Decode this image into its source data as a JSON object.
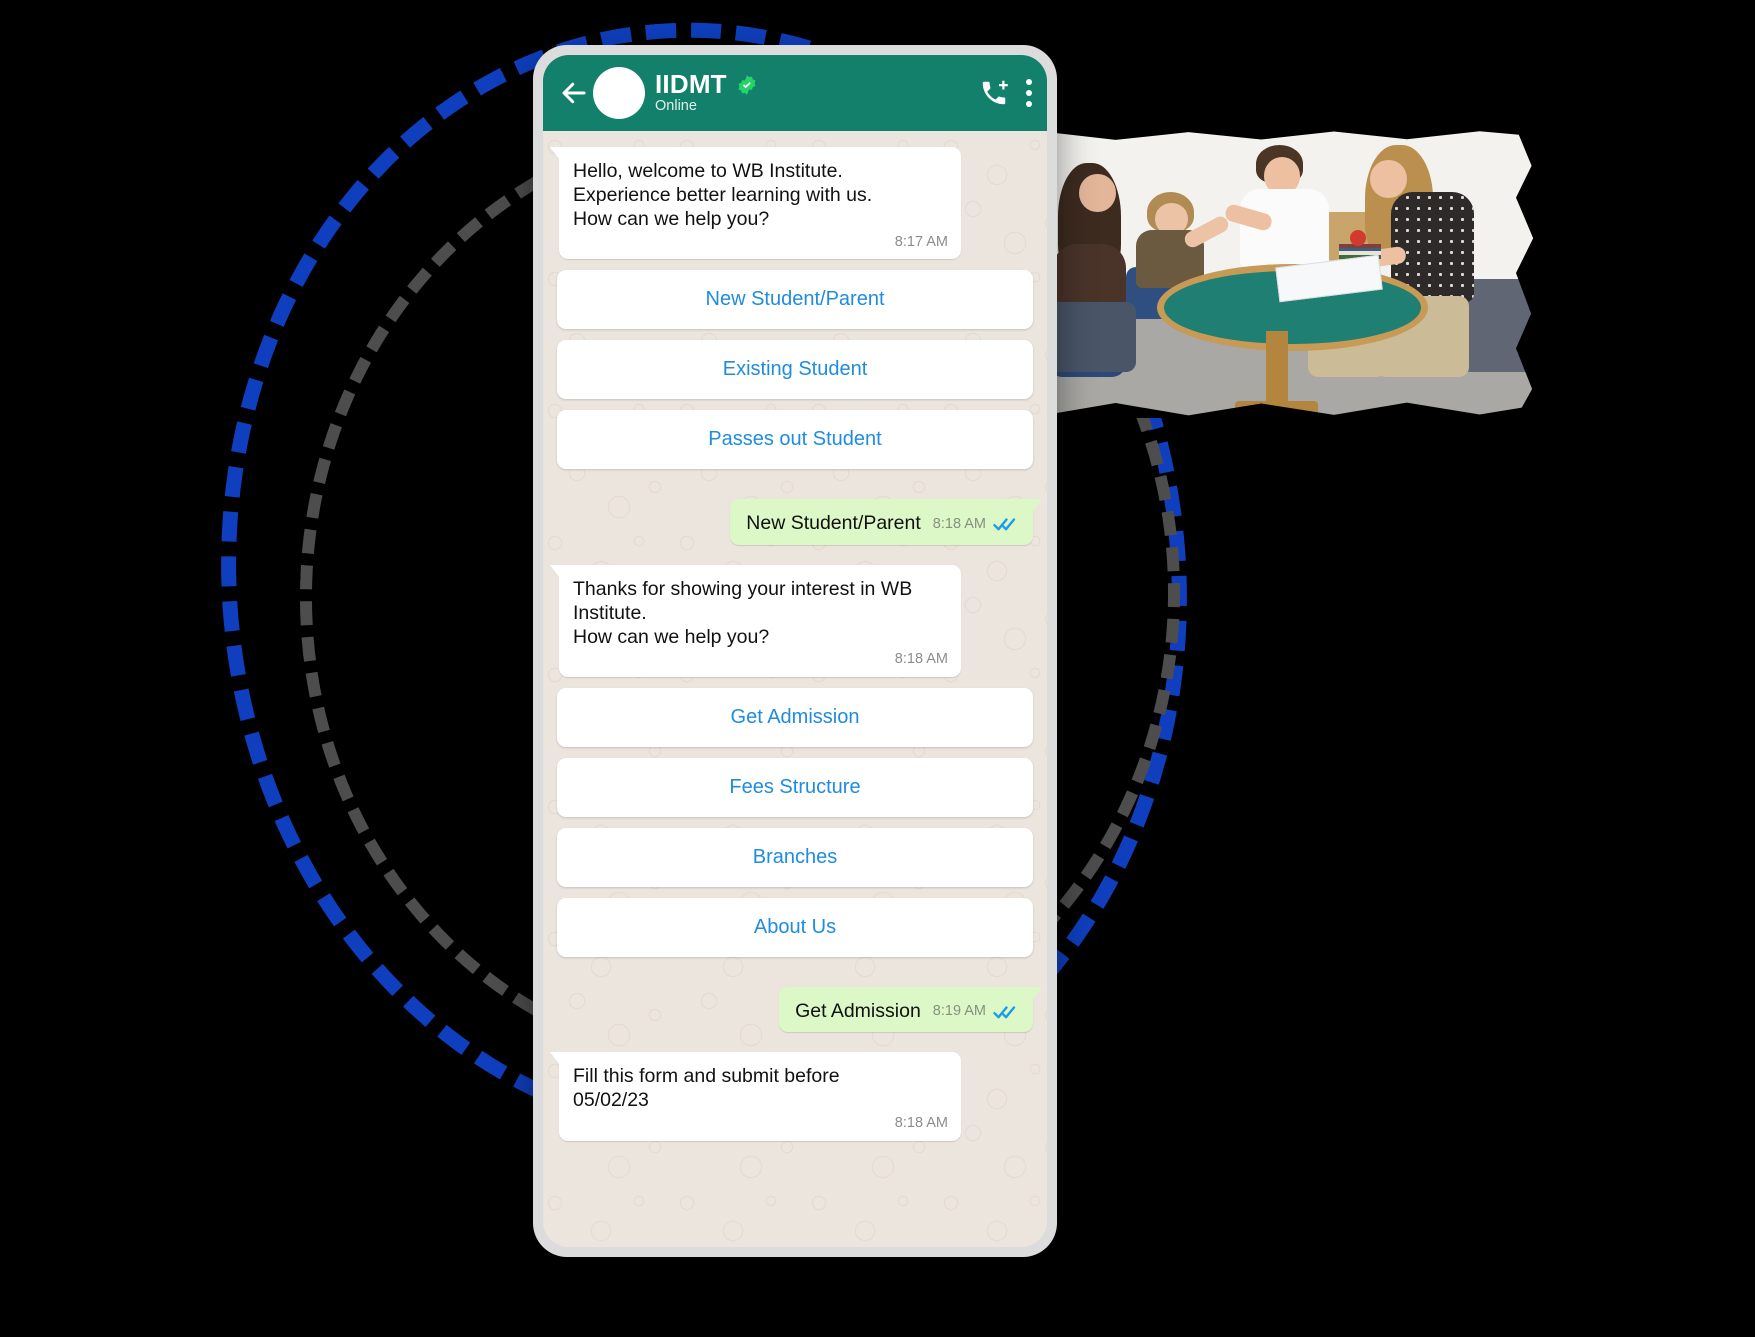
{
  "background": {
    "color": "#000000"
  },
  "decorations": {
    "outer_ring": {
      "name": "dashed-ring-blue",
      "color": "#0f3fbe",
      "style": "dashed"
    },
    "inner_ring": {
      "name": "dashed-ring-gray",
      "color": "#4d4d4d",
      "style": "dashed"
    },
    "photo": {
      "name": "parent-teacher-meeting-photo",
      "description": "Two parents, a boy and a teacher seated around a round green table in a classroom with a whiteboard"
    }
  },
  "phone": {
    "frame_color": "#dcdcdc",
    "header": {
      "background": "#12806a",
      "back_icon": "back-arrow-icon",
      "avatar": "contact-avatar",
      "title": "IIDMT",
      "verified_badge": "verified-badge-icon",
      "verified_color": "#25d366",
      "status": "Online",
      "call_icon": "add-call-icon",
      "menu_icon": "overflow-menu-icon"
    },
    "chat": {
      "bubble_in_color": "#ffffff",
      "bubble_out_color": "#dcf8c6",
      "option_text_color": "#1f8ce0",
      "tick_color": "#1f9ce8",
      "messages": [
        {
          "id": "msg-welcome",
          "type": "incoming",
          "text": "Hello, welcome to WB Institute.\nExperience better learning with us.\nHow can we help you?",
          "time": "8:17 AM"
        },
        {
          "id": "options-1",
          "type": "options",
          "buttons": [
            {
              "id": "opt-new-student-parent",
              "label": "New Student/Parent"
            },
            {
              "id": "opt-existing-student",
              "label": "Existing Student"
            },
            {
              "id": "opt-passes-out-student",
              "label": "Passes out Student"
            }
          ]
        },
        {
          "id": "msg-reply-1",
          "type": "outgoing",
          "text": "New Student/Parent",
          "time": "8:18 AM",
          "status": "read"
        },
        {
          "id": "msg-thanks",
          "type": "incoming",
          "text": "Thanks for showing your interest in WB Institute.\nHow can we help you?",
          "time": "8:18 AM"
        },
        {
          "id": "options-2",
          "type": "options",
          "buttons": [
            {
              "id": "opt-get-admission",
              "label": "Get Admission"
            },
            {
              "id": "opt-fees-structure",
              "label": "Fees Structure"
            },
            {
              "id": "opt-branches",
              "label": "Branches"
            },
            {
              "id": "opt-about-us",
              "label": "About Us"
            }
          ]
        },
        {
          "id": "msg-reply-2",
          "type": "outgoing",
          "text": "Get Admission",
          "time": "8:19 AM",
          "status": "read"
        },
        {
          "id": "msg-form",
          "type": "incoming",
          "text": "Fill this form and submit before 05/02/23",
          "time": "8:18 AM"
        }
      ]
    }
  },
  "messages_flat": {
    "m1_l1": "Hello, welcome to WB Institute.",
    "m1_l2": "Experience better learning with us.",
    "m1_l3": "How can we help you?",
    "m1_time": "8:17 AM",
    "o1_b1": "New Student/Parent",
    "o1_b2": "Existing Student",
    "o1_b3": "Passes out Student",
    "r1_text": "New Student/Parent",
    "r1_time": "8:18 AM",
    "m2_l1": "Thanks for showing your interest in WB Institute.",
    "m2_l2": "How can we help you?",
    "m2_time": "8:18 AM",
    "o2_b1": "Get Admission",
    "o2_b2": "Fees Structure",
    "o2_b3": "Branches",
    "o2_b4": "About Us",
    "r2_text": "Get Admission",
    "r2_time": "8:19 AM",
    "m3_l1": "Fill this form and submit before",
    "m3_l2": "05/02/23",
    "m3_time": "8:18 AM"
  }
}
